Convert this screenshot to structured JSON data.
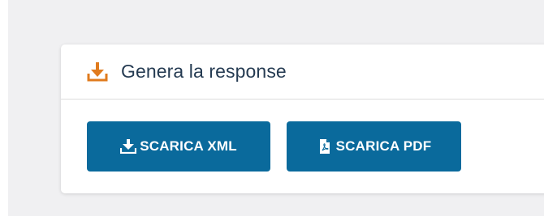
{
  "panel": {
    "title": "Genera la response",
    "icon": "download-tray-icon",
    "icon_color": "#e07b1e"
  },
  "buttons": {
    "xml_label": "SCARICA XML",
    "xml_icon": "download-icon",
    "pdf_label": "SCARICA PDF",
    "pdf_icon": "pdf-file-icon",
    "color": "#0a6a9c"
  }
}
